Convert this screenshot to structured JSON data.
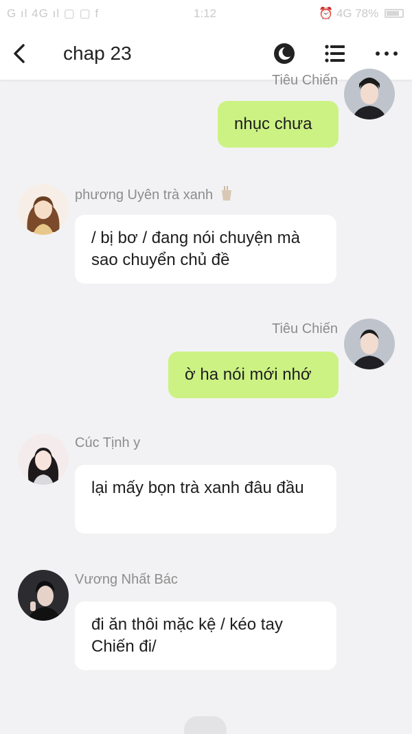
{
  "status_bar": {
    "left": "G ıl 4G ıl  ▢ ▢ f",
    "time": "1:12",
    "right": "⏰ 4G 78%"
  },
  "header": {
    "title": "chap 23"
  },
  "messages": [
    {
      "sender": "Tiêu Chiến",
      "text": "nhục chưa",
      "side": "right"
    },
    {
      "sender": "phương Uyên trà xanh",
      "text": "/ bị bơ / đang nói chuyện mà sao chuyển chủ đề",
      "side": "left"
    },
    {
      "sender": "Tiêu Chiến",
      "text": "ờ ha nói mới nhớ",
      "side": "right"
    },
    {
      "sender": "Cúc Tịnh y",
      "text": "lại mấy bọn trà xanh đâu đầu",
      "side": "left"
    },
    {
      "sender": "Vương Nhất Bác",
      "text": "đi ăn thôi mặc kệ / kéo tay Chiến đi/",
      "side": "left"
    }
  ],
  "colors": {
    "my_bubble": "#ccf284",
    "their_bubble": "#ffffff",
    "background": "#f2f2f4"
  }
}
